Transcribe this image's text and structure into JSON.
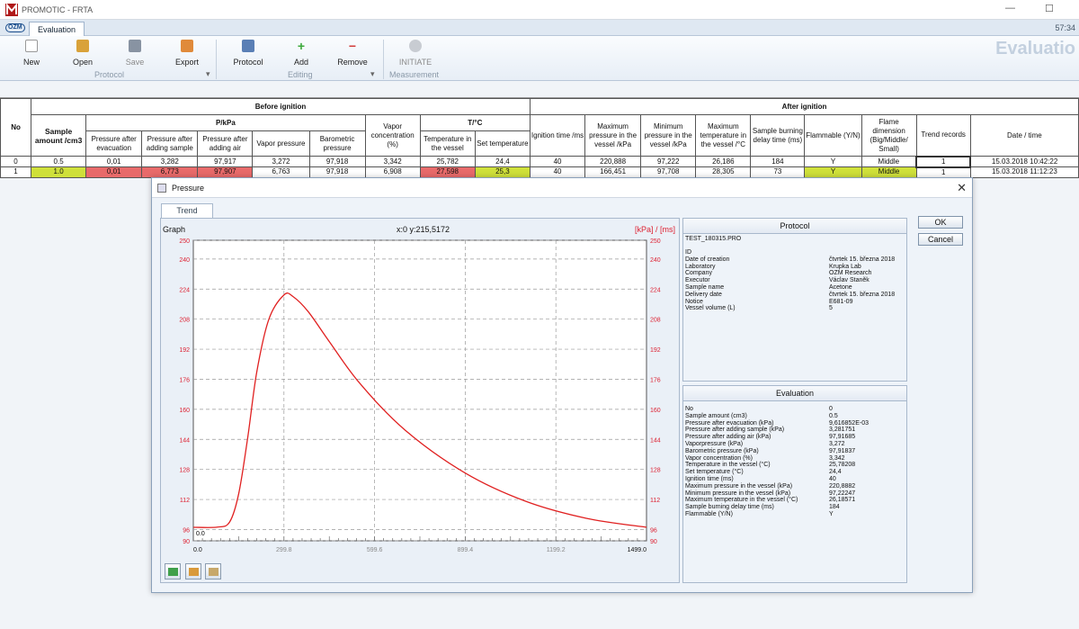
{
  "window": {
    "title": "PROMOTIC - FRTA",
    "clock": "57:34"
  },
  "tabs": {
    "active": "Evaluation"
  },
  "ribbon": {
    "buttons": {
      "new": "New",
      "open": "Open",
      "save": "Save",
      "export": "Export",
      "protocol": "Protocol",
      "add": "Add",
      "remove": "Remove",
      "initiate": "INITIATE"
    },
    "groups": {
      "protocol": "Protocol",
      "editing": "Editing",
      "measurement": "Measurement"
    },
    "watermark": "Evaluatio"
  },
  "table": {
    "headers": {
      "no": "No",
      "before": "Before ignition",
      "after": "After ignition",
      "sample": "Sample amount /cm3",
      "p_kpa": "P/kPa",
      "tc": "T/°C",
      "p_evac": "Pressure after evacuation",
      "p_sample": "Pressure after adding sample",
      "p_air": "Pressure after adding air",
      "vapor_p": "Vapor pressure",
      "baro": "Barometric pressure",
      "vapor_c": "Vapor concentration (%)",
      "t_vessel": "Temperature in the vessel",
      "set_t": "Set temperature",
      "ign": "Ignition time /ms",
      "max_p": "Maximum pressure in the vessel /kPa",
      "min_p": "Minimum pressure in the vessel /kPa",
      "max_t": "Maximum temperature in the vessel /°C",
      "burn": "Sample burning delay time (ms)",
      "flam": "Flammable (Y/N)",
      "flame": "Flame dimension (Big/Middle/ Small)",
      "trend": "Trend records",
      "date": "Date / time"
    },
    "rows": [
      {
        "no": "0",
        "sample": "0.5",
        "p_evac": "0,01",
        "p_sample": "3,282",
        "p_air": "97,917",
        "vapor_p": "3,272",
        "baro": "97,918",
        "vapor_c": "3,342",
        "t_vessel": "25,782",
        "set_t": "24,4",
        "ign": "40",
        "max_p": "220,888",
        "min_p": "97,222",
        "max_t": "26,186",
        "burn": "184",
        "flam": "Y",
        "flame": "Middle",
        "trend": "1",
        "date": "15.03.2018 10:42:22"
      },
      {
        "no": "1",
        "sample": "1.0",
        "p_evac": "0,01",
        "p_sample": "6,773",
        "p_air": "97,907",
        "vapor_p": "6,763",
        "baro": "97,918",
        "vapor_c": "6,908",
        "t_vessel": "27,598",
        "set_t": "25,3",
        "ign": "40",
        "max_p": "166,451",
        "min_p": "97,708",
        "max_t": "28,305",
        "burn": "73",
        "flam": "Y",
        "flame": "Middle",
        "trend": "1",
        "date": "15.03.2018 11:12:23"
      }
    ]
  },
  "dialog": {
    "title": "Pressure",
    "tab": "Trend",
    "graph_label": "Graph",
    "cursor": "x:0 y:215,5172",
    "units": "[kPa] / [ms]",
    "ok": "OK",
    "cancel": "Cancel",
    "protocol": {
      "title": "Protocol",
      "name": "TEST_180315.PRO",
      "fields": [
        {
          "k": "ID",
          "v": ""
        },
        {
          "k": "Date of creation",
          "v": "čtvrtek 15. března 2018"
        },
        {
          "k": "Laboratory",
          "v": "Krupka Lab"
        },
        {
          "k": "Company",
          "v": "OZM Research"
        },
        {
          "k": "Executor",
          "v": "Václav Staněk"
        },
        {
          "k": "Sample name",
          "v": "Acetone"
        },
        {
          "k": "Delivery date",
          "v": "čtvrtek 15. března 2018"
        },
        {
          "k": "Notice",
          "v": "E681-09"
        },
        {
          "k": "Vessel volume (L)",
          "v": "5"
        }
      ]
    },
    "evaluation": {
      "title": "Evaluation",
      "fields": [
        {
          "k": "No",
          "v": "0"
        },
        {
          "k": "Sample amount (cm3)",
          "v": "0.5"
        },
        {
          "k": "Pressure after evacuation (kPa)",
          "v": "9,616852E-03"
        },
        {
          "k": "Pressure after adding sample (kPa)",
          "v": "3,281751"
        },
        {
          "k": "Pressure after adding air (kPa)",
          "v": "97,91685"
        },
        {
          "k": "Vaporpressure (kPa)",
          "v": "3,272"
        },
        {
          "k": "Barometric pressure (kPa)",
          "v": "97,91837"
        },
        {
          "k": "Vapor concentration (%)",
          "v": "3,342"
        },
        {
          "k": "Temperature in the vessel (°C)",
          "v": "25,78208"
        },
        {
          "k": "Set temperature (°C)",
          "v": "24,4"
        },
        {
          "k": "Ignition time (ms)",
          "v": "40"
        },
        {
          "k": "Maximum pressure in the vessel (kPa)",
          "v": "220,8882"
        },
        {
          "k": "Minimum pressure in the vessel (kPa)",
          "v": "97,22247"
        },
        {
          "k": "Maximum temperature in the vessel (°C)",
          "v": "26,18571"
        },
        {
          "k": "Sample burning delay time (ms)",
          "v": "184"
        },
        {
          "k": "Flammable (Y/N)",
          "v": "Y"
        }
      ]
    }
  },
  "chart_data": {
    "type": "line",
    "xlim": [
      0,
      1499
    ],
    "ylim": [
      90,
      250
    ],
    "x_ticks": [
      "0.0",
      "299.8",
      "599.6",
      "899.4",
      "1199.2",
      "1499.0"
    ],
    "y_ticks": [
      "250",
      "240",
      "224",
      "208",
      "192",
      "176",
      "160",
      "144",
      "128",
      "112",
      "96",
      "90"
    ],
    "y_tick_values": [
      250,
      240,
      224,
      208,
      192,
      176,
      160,
      144,
      128,
      112,
      96,
      90
    ],
    "x_tick_values": [
      0,
      299.8,
      599.6,
      899.4,
      1199.2,
      1499
    ],
    "corner_label": "0.0",
    "series": [
      {
        "color": "#e02020",
        "x": [
          0,
          80,
          120,
          150,
          180,
          210,
          250,
          300,
          330,
          380,
          450,
          550,
          700,
          900,
          1100,
          1300,
          1499
        ],
        "y": [
          97.2,
          97.3,
          100,
          115,
          145,
          180,
          208,
          220.9,
          220,
          212,
          196,
          174,
          149,
          126,
          111,
          102,
          97.2
        ]
      }
    ]
  }
}
